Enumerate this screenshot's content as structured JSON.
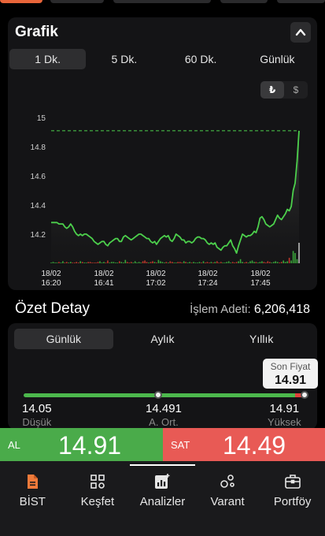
{
  "chart": {
    "title": "Grafik",
    "range_tabs": [
      "1 Dk.",
      "5 Dk.",
      "60 Dk.",
      "Günlük"
    ],
    "active_range": 0,
    "currency": [
      "₺",
      "$"
    ],
    "active_currency": 0
  },
  "chart_data": {
    "type": "line",
    "y_ticks": [
      "15",
      "14.8",
      "14.6",
      "14.4",
      "14.2"
    ],
    "ylim": [
      14.0,
      15.05
    ],
    "x_ticks": [
      {
        "date": "18/02",
        "time": "16:20"
      },
      {
        "date": "18/02",
        "time": "16:41"
      },
      {
        "date": "18/02",
        "time": "17:02"
      },
      {
        "date": "18/02",
        "time": "17:24"
      },
      {
        "date": "18/02",
        "time": "17:45"
      }
    ],
    "reference_line": 14.91,
    "grid": false,
    "line_color": "#4cd04c",
    "values": [
      14.28,
      14.28,
      14.28,
      14.28,
      14.27,
      14.27,
      14.27,
      14.25,
      14.24,
      14.25,
      14.27,
      14.25,
      14.22,
      14.2,
      14.19,
      14.2,
      14.19,
      14.2,
      14.2,
      14.19,
      14.18,
      14.17,
      14.15,
      14.14,
      14.13,
      14.14,
      14.15,
      14.15,
      14.13,
      14.12,
      14.14,
      14.15,
      14.16,
      14.17,
      14.17,
      14.15,
      14.15,
      14.18,
      14.19,
      14.18,
      14.17,
      14.16,
      14.17,
      14.18,
      14.19,
      14.2,
      14.2,
      14.19,
      14.18,
      14.17,
      14.17,
      14.15,
      14.14,
      14.15,
      14.13,
      14.15,
      14.17,
      14.18,
      14.19,
      14.18,
      14.19,
      14.16,
      14.15,
      14.17,
      14.2,
      14.19,
      14.18,
      14.16,
      14.16,
      14.14,
      14.15,
      14.15,
      14.14,
      14.15,
      14.17,
      14.18,
      14.18,
      14.17,
      14.17,
      14.16,
      14.14,
      14.13,
      14.14,
      14.13,
      14.14,
      14.11,
      14.1,
      14.09,
      14.11,
      14.12,
      14.12,
      14.14,
      14.16,
      14.12,
      14.1,
      14.07,
      14.12,
      14.16,
      14.2,
      14.19,
      14.18,
      14.19,
      14.19,
      14.2,
      14.22,
      14.21,
      14.25,
      14.31,
      14.32,
      14.3,
      14.27,
      14.26,
      14.25,
      14.26,
      14.27,
      14.3,
      14.33,
      14.31,
      14.3,
      14.32,
      14.34,
      14.37,
      14.36,
      14.39,
      14.5,
      14.55,
      14.7,
      14.91
    ],
    "volumes": [
      1,
      2,
      1,
      1,
      2,
      1,
      3,
      1,
      2,
      1,
      2,
      1,
      1,
      2,
      1,
      3,
      2,
      1,
      1,
      2,
      2,
      1,
      1,
      1,
      2,
      3,
      1,
      2,
      1,
      4,
      1,
      2,
      2,
      1,
      1,
      3,
      2,
      1,
      5,
      2,
      1,
      2,
      1,
      3,
      1,
      2,
      1,
      3,
      4,
      2,
      1,
      2,
      3,
      2,
      1,
      5,
      3,
      2,
      1,
      2,
      1,
      3,
      2,
      1,
      1,
      2,
      2,
      1,
      3,
      2,
      1,
      2,
      1,
      2,
      1,
      1,
      2,
      1,
      3,
      1,
      2,
      1,
      2,
      1,
      2,
      3,
      1,
      2,
      1,
      1,
      2,
      3,
      1,
      2,
      1,
      2,
      3,
      6,
      2,
      1,
      2,
      1,
      3,
      4,
      2,
      2,
      1,
      2,
      3,
      2,
      1,
      3,
      2,
      1,
      2,
      3,
      2,
      1,
      2,
      4,
      2,
      3,
      8,
      4,
      18,
      15,
      6,
      30
    ]
  },
  "summary": {
    "title": "Özet Detay",
    "volume_label": "İşlem Adeti:",
    "volume_value": "6,206,418",
    "period_tabs": [
      "Günlük",
      "Aylık",
      "Yıllık"
    ],
    "active_period": 0,
    "last_price_label": "Son Fiyat",
    "last_price": "14.91",
    "low_value": "14.05",
    "low_label": "Düşük",
    "avg_value": "14.491",
    "avg_label": "A. Ort.",
    "high_value": "14.91",
    "high_label": "Yüksek",
    "avg_position_fraction": 0.48,
    "last_position_fraction": 1.0
  },
  "trade": {
    "buy_label": "AL",
    "buy_price": "14.91",
    "sell_label": "SAT",
    "sell_price": "14.49",
    "buy_color": "#4aab4a",
    "sell_color": "#e85a55"
  },
  "nav": {
    "items": [
      {
        "label": "BİST",
        "icon": "document-icon"
      },
      {
        "label": "Keşfet",
        "icon": "grid-icon"
      },
      {
        "label": "Analizler",
        "icon": "chart-icon"
      },
      {
        "label": "Varant",
        "icon": "bubbles-icon"
      },
      {
        "label": "Portföy",
        "icon": "briefcase-icon"
      }
    ],
    "active": 2,
    "bist_icon_color": "#f07a3a"
  }
}
